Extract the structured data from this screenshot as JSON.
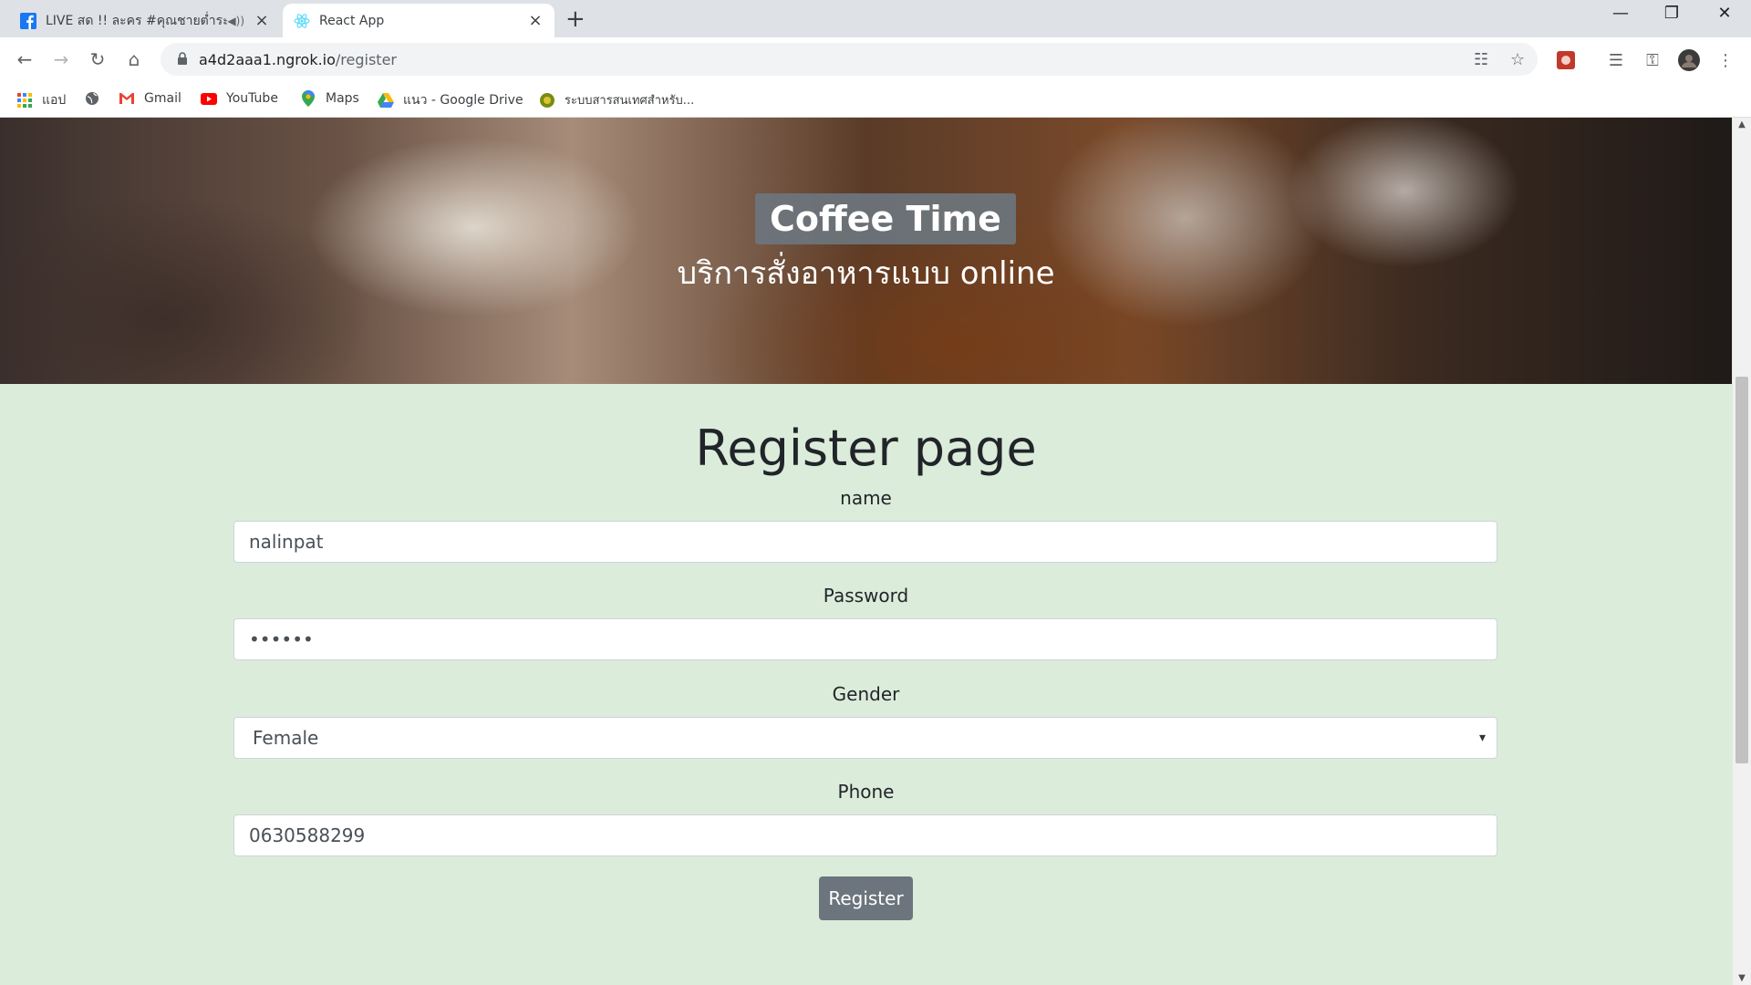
{
  "browser": {
    "tabs": [
      {
        "title": "LIVE สด !! ละคร #คุณชายต่ำระเบียบ",
        "icon": "facebook-icon",
        "active": false
      },
      {
        "title": "React App",
        "icon": "react-icon",
        "active": true
      }
    ],
    "new_tab_label": "+",
    "url_host": "a4d2aaa1.ngrok.io",
    "url_path": "/register",
    "bookmarks": [
      {
        "label": "แอป",
        "icon": "apps-grid-icon"
      },
      {
        "label": "",
        "icon": "globe-icon"
      },
      {
        "label": "Gmail",
        "icon": "gmail-icon"
      },
      {
        "label": "YouTube",
        "icon": "youtube-icon"
      },
      {
        "label": "Maps",
        "icon": "maps-icon"
      },
      {
        "label": "แนว - Google Drive",
        "icon": "google-drive-icon"
      },
      {
        "label": "ระบบสารสนเทศสำหรับ...",
        "icon": "site-icon"
      }
    ]
  },
  "page": {
    "hero_title": "Coffee Time",
    "hero_subtitle": "บริการสั่งอาหารแบบ online",
    "heading": "Register page",
    "form": {
      "name_label": "name",
      "name_value": "nalinpat",
      "password_label": "Password",
      "password_value": "••••••",
      "gender_label": "Gender",
      "gender_value": "Female",
      "phone_label": "Phone",
      "phone_value": "0630588299",
      "submit_label": "Register"
    }
  },
  "colors": {
    "page_background": "#dcecdb",
    "button": "#6c757d",
    "hero_title_bg": "#6c757d"
  }
}
